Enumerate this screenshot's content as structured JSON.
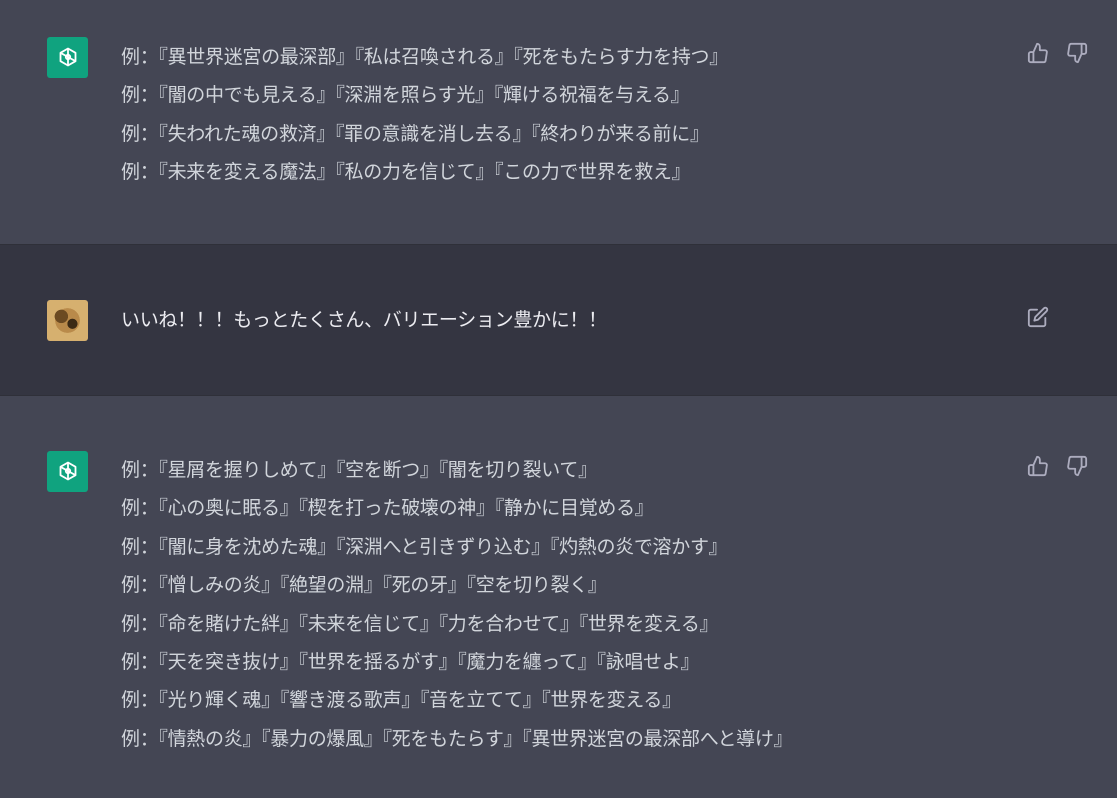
{
  "messages": [
    {
      "role": "assistant",
      "lines": [
        "例：『異世界迷宮の最深部』『私は召喚される』『死をもたらす力を持つ』",
        "例：『闇の中でも見える』『深淵を照らす光』『輝ける祝福を与える』",
        "例：『失われた魂の救済』『罪の意識を消し去る』『終わりが来る前に』",
        "例：『未来を変える魔法』『私の力を信じて』『この力で世界を救え』"
      ]
    },
    {
      "role": "user",
      "text": "いいね！！！もっとたくさん、バリエーション豊かに！！"
    },
    {
      "role": "assistant",
      "lines": [
        "例：『星屑を握りしめて』『空を断つ』『闇を切り裂いて』",
        "例：『心の奥に眠る』『楔を打った破壊の神』『静かに目覚める』",
        "例：『闇に身を沈めた魂』『深淵へと引きずり込む』『灼熱の炎で溶かす』",
        "例：『憎しみの炎』『絶望の淵』『死の牙』『空を切り裂く』",
        "例：『命を賭けた絆』『未来を信じて』『力を合わせて』『世界を変える』",
        "例：『天を突き抜け』『世界を揺るがす』『魔力を纏って』『詠唱せよ』",
        "例：『光り輝く魂』『響き渡る歌声』『音を立てて』『世界を変える』",
        "例：『情熱の炎』『暴力の爆風』『死をもたらす』『異世界迷宮の最深部へと導け』"
      ]
    }
  ],
  "icons": {
    "assistant_avatar": "openai-logo-icon",
    "user_avatar": "user-photo-avatar",
    "like": "thumbs-up-icon",
    "dislike": "thumbs-down-icon",
    "edit": "edit-icon"
  },
  "colors": {
    "assistant_bg": "#444654",
    "user_bg": "#343541",
    "accent": "#10a37f",
    "text": "#d1d5db",
    "icon": "#acacbe"
  }
}
